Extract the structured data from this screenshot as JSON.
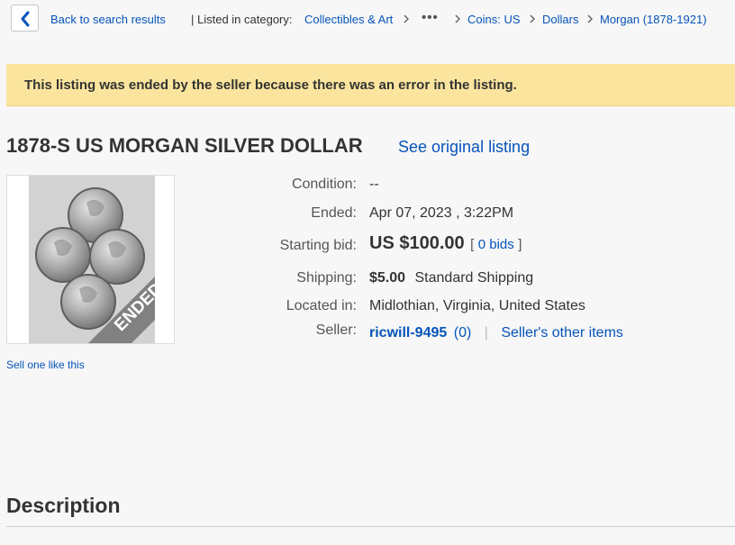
{
  "breadcrumb": {
    "back_label": "Back to search results",
    "category_prefix": "| Listed in category:",
    "items": [
      "Collectibles & Art",
      "Coins: US",
      "Dollars",
      "Morgan (1878-1921)"
    ],
    "ellipsis": "•••"
  },
  "notice": {
    "text": "This listing was ended by the seller because there was an error in the listing."
  },
  "listing": {
    "title": "1878-S US MORGAN SILVER DOLLAR",
    "see_original": "See original listing",
    "image_badge": "ENDED",
    "sell_one": "Sell one like this"
  },
  "details": {
    "condition_label": "Condition:",
    "condition_value": "--",
    "ended_label": "Ended:",
    "ended_value": "Apr 07, 2023 , 3:22PM",
    "bid_label": "Starting bid:",
    "bid_value": "US $100.00",
    "bids_open": "[",
    "bids_text": "0 bids",
    "bids_close": "]",
    "shipping_label": "Shipping:",
    "shipping_cost": "$5.00",
    "shipping_method": "Standard Shipping",
    "location_label": "Located in:",
    "location_value": "Midlothian, Virginia, United States",
    "seller_label": "Seller:",
    "seller_name": "ricwill-9495",
    "seller_feedback": "(0)",
    "seller_sep": "|",
    "seller_other": "Seller's other items"
  },
  "description": {
    "heading": "Description"
  },
  "colors": {
    "link": "#0654ba",
    "banner": "#fbe59e",
    "background": "#f7f7f7"
  }
}
